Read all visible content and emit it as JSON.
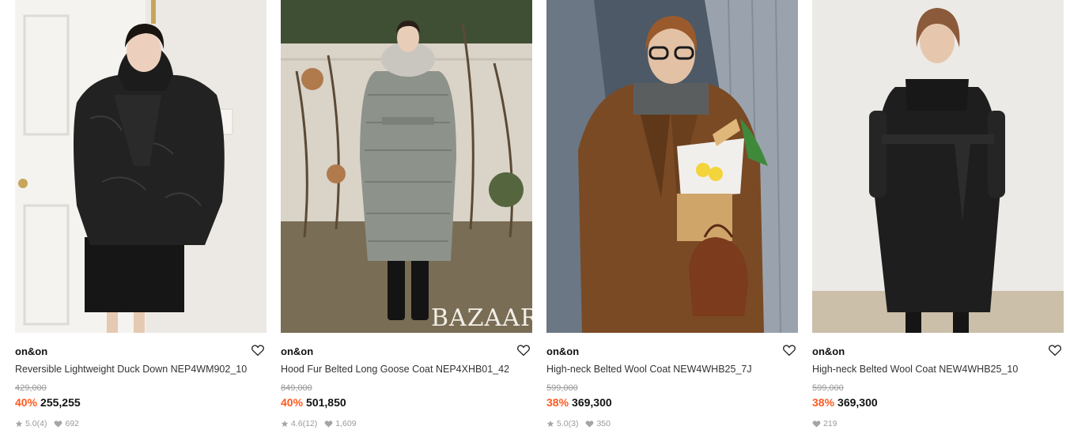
{
  "products": [
    {
      "brand": "on&on",
      "name": "Reversible Lightweight Duck Down NEP4WM902_10",
      "original_price": "429,000",
      "discount": "40%",
      "price": "255,255",
      "rating": "5.0",
      "reviews": "(4)",
      "likes": "692",
      "image": {
        "subject": "black-quilted-puffer-jacket",
        "bg": "#ece9e4",
        "coat": "#1b1b1b"
      }
    },
    {
      "brand": "on&on",
      "name": "Hood Fur Belted Long Goose Coat NEP4XHB01_42",
      "original_price": "849,000",
      "discount": "40%",
      "price": "501,850",
      "rating": "4.6",
      "reviews": "(12)",
      "likes": "1,609",
      "image": {
        "subject": "grey-long-goose-down-coat",
        "bg": "#9a8f7e",
        "coat": "#8d938a",
        "watermark": "BAZAAR"
      }
    },
    {
      "brand": "on&on",
      "name": "High-neck Belted Wool Coat NEW4WHB25_7J",
      "original_price": "599,000",
      "discount": "38%",
      "price": "369,300",
      "rating": "5.0",
      "reviews": "(3)",
      "likes": "350",
      "image": {
        "subject": "brown-belted-wool-coat",
        "bg": "#5c6b78",
        "coat": "#7a4a25"
      }
    },
    {
      "brand": "on&on",
      "name": "High-neck Belted Wool Coat NEW4WHB25_10",
      "original_price": "599,000",
      "discount": "38%",
      "price": "369,300",
      "rating": "",
      "reviews": "",
      "likes": "219",
      "image": {
        "subject": "black-belted-wool-coat",
        "bg": "#e9e7e3",
        "coat": "#1e1e1e"
      }
    }
  ],
  "colors": {
    "discount": "#ff5a1f",
    "muted": "#999999"
  }
}
